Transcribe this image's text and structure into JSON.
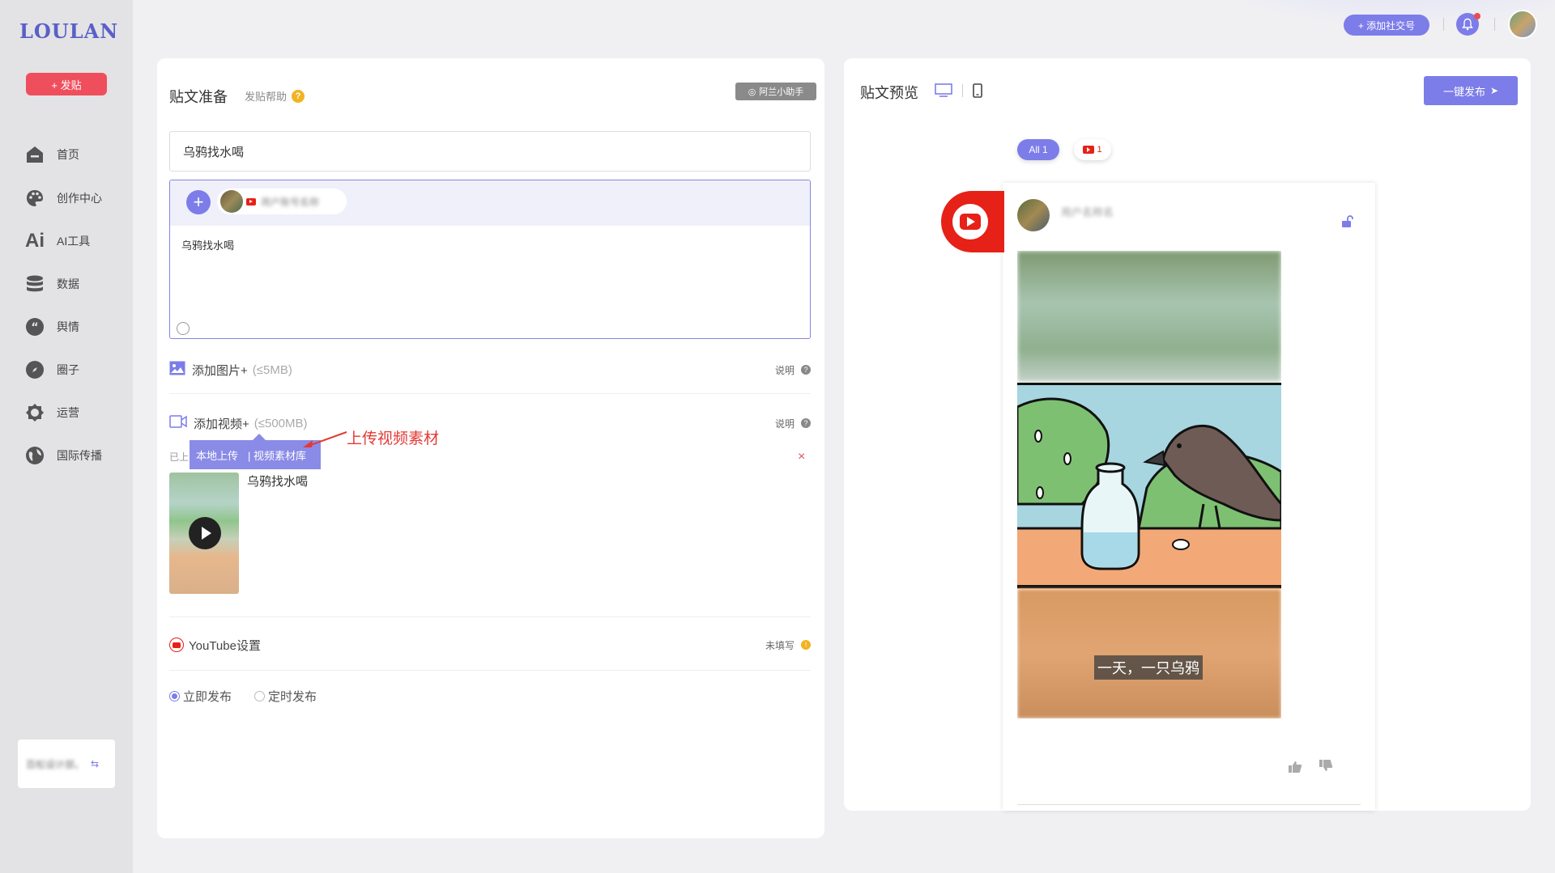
{
  "brand": {
    "logo": "LOULAN",
    "post_button": "+ 发贴"
  },
  "nav": [
    {
      "label": "首页",
      "icon": "home-icon"
    },
    {
      "label": "创作中心",
      "icon": "palette-icon"
    },
    {
      "label": "AI工具",
      "icon": "ai-icon"
    },
    {
      "label": "数据",
      "icon": "database-icon"
    },
    {
      "label": "舆情",
      "icon": "quote-icon"
    },
    {
      "label": "圈子",
      "icon": "compass-icon"
    },
    {
      "label": "运营",
      "icon": "badge-icon"
    },
    {
      "label": "国际传播",
      "icon": "globe-icon"
    }
  ],
  "user_card": {
    "name": "百松设计部。",
    "switch_icon": "switch-icon"
  },
  "topbar": {
    "add_social": "+ 添加社交号",
    "bell_icon": "bell-icon",
    "avatar_icon": "avatar-icon"
  },
  "left": {
    "title": "贴文准备",
    "help": "发贴帮助",
    "help_mark": "?",
    "assistant": "阿兰小助手",
    "title_value": "乌鸦找水喝",
    "account_name": "用户账号名称",
    "body_text": "乌鸦找水喝",
    "add_image": "添加图片+",
    "add_image_limit": "(≤5MB)",
    "add_video": "添加视频+",
    "add_video_limit": "(≤500MB)",
    "note_label": "说明",
    "note_mark": "?",
    "upload_local": "本地上传",
    "upload_library": "| 视频素材库",
    "annotation": "上传视频素材",
    "uploaded_label": "已上",
    "close_mark": "×",
    "video_name": "乌鸦找水喝",
    "youtube_settings": "YouTube设置",
    "not_filled": "未填写",
    "warn_mark": "!",
    "publish_now": "立即发布",
    "publish_scheduled": "定时发布"
  },
  "right": {
    "title": "贴文预览",
    "publish_button": "一键发布",
    "tab_all": "All 1",
    "tab_youtube_count": "1",
    "card_name": "用户名称名",
    "caption": "一天，一只乌鸦"
  },
  "colors": {
    "accent": "#7c7de9",
    "red": "#e62117",
    "post": "#ef4f5c"
  }
}
